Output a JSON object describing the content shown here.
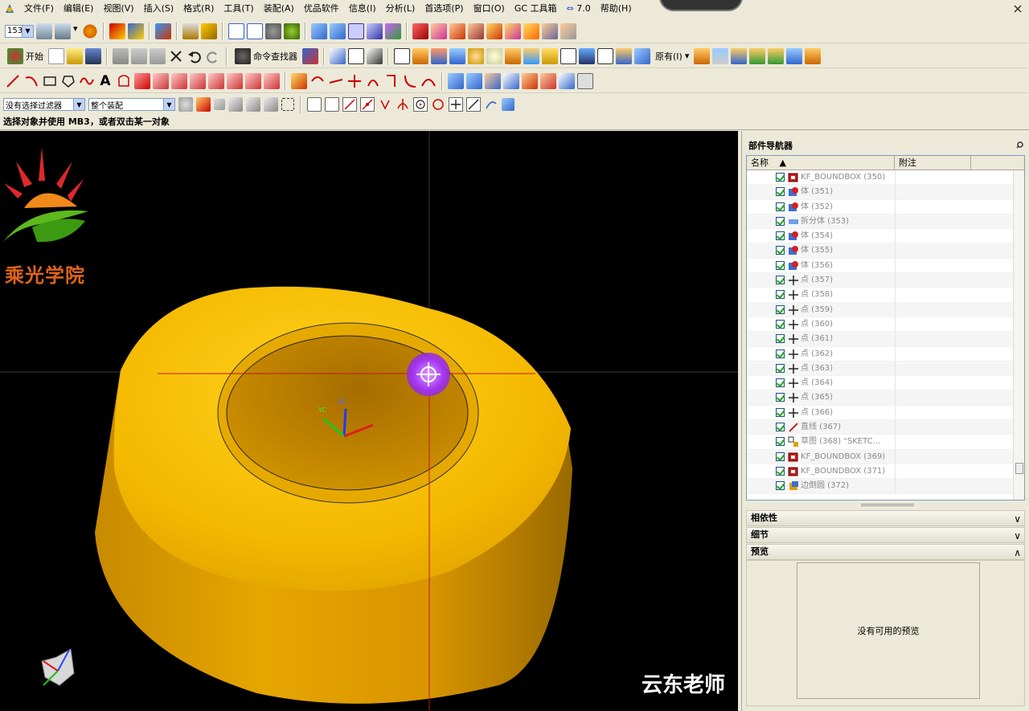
{
  "menubar": {
    "items": [
      "文件(F)",
      "编辑(E)",
      "视图(V)",
      "插入(S)",
      "格式(R)",
      "工具(T)",
      "装配(A)",
      "优品软件",
      "信息(I)",
      "分析(L)",
      "首选项(P)",
      "窗口(O)",
      "GC 工具箱",
      "7.0",
      "帮助(H)"
    ]
  },
  "toolbar": {
    "layer_value": "153",
    "start_label": "开始",
    "command_finder_label": "命令查找器",
    "original_label": "原有(I)"
  },
  "selection": {
    "filter_value": "没有选择过滤器",
    "scope_value": "整个装配"
  },
  "status": {
    "prompt": "选择对象并使用 MB3，或者双击某一对象"
  },
  "viewport": {
    "brand_text": "乘光学院",
    "watermark": "云东老师",
    "axis_labels": [
      "YC",
      "ZC"
    ]
  },
  "navigator": {
    "title": "部件导航器",
    "col_name": "名称",
    "col_note": "附注",
    "rows": [
      {
        "label": "KF_BOUNDBOX (350)",
        "icon": "boundbox-icon"
      },
      {
        "label": "体 (351)",
        "icon": "body-icon"
      },
      {
        "label": "体 (352)",
        "icon": "body-icon"
      },
      {
        "label": "拆分体 (353)",
        "icon": "split-body-icon"
      },
      {
        "label": "体 (354)",
        "icon": "body-icon"
      },
      {
        "label": "体 (355)",
        "icon": "body-icon"
      },
      {
        "label": "体 (356)",
        "icon": "body-icon"
      },
      {
        "label": "点 (357)",
        "icon": "point-icon"
      },
      {
        "label": "点 (358)",
        "icon": "point-icon"
      },
      {
        "label": "点 (359)",
        "icon": "point-icon"
      },
      {
        "label": "点 (360)",
        "icon": "point-icon"
      },
      {
        "label": "点 (361)",
        "icon": "point-icon"
      },
      {
        "label": "点 (362)",
        "icon": "point-icon"
      },
      {
        "label": "点 (363)",
        "icon": "point-icon"
      },
      {
        "label": "点 (364)",
        "icon": "point-icon"
      },
      {
        "label": "点 (365)",
        "icon": "point-icon"
      },
      {
        "label": "点 (366)",
        "icon": "point-icon"
      },
      {
        "label": "直线 (367)",
        "icon": "line-icon"
      },
      {
        "label": "草图 (368) \"SKETC...",
        "icon": "sketch-icon"
      },
      {
        "label": "KF_BOUNDBOX (369)",
        "icon": "boundbox-icon"
      },
      {
        "label": "KF_BOUNDBOX (371)",
        "icon": "boundbox-icon"
      },
      {
        "label": "边倒圆 (372)",
        "icon": "edge-blend-icon"
      }
    ],
    "sections": {
      "dependency": "相依性",
      "details": "细节",
      "preview": "预览"
    },
    "preview_empty": "没有可用的预览"
  },
  "colors": {
    "part_yellow": "#f2b600",
    "viewport_bg": "#000000",
    "ui_bg": "#ece9d8",
    "cursor_purple": "#a335f2"
  }
}
